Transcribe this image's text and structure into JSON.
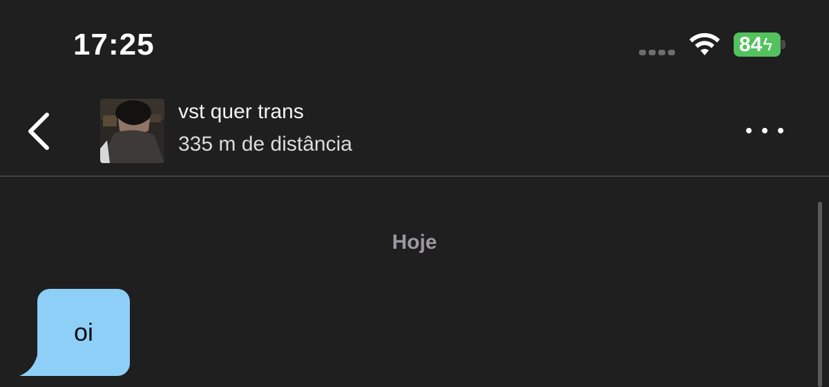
{
  "status_bar": {
    "time": "17:25",
    "battery_percent": "84",
    "charging_icon": "bolt-icon",
    "wifi_icon": "wifi-icon",
    "cellular_icon": "signal-dots-icon",
    "battery_color": "#53c15d"
  },
  "header": {
    "back_icon": "chevron-left-icon",
    "contact_name": "vst quer trans",
    "distance": "335 m de distância",
    "more_icon": "ellipsis-icon"
  },
  "chat": {
    "date_separator": "Hoje",
    "messages": [
      {
        "text": "oi",
        "bubble_color": "#8dcff7"
      }
    ]
  }
}
